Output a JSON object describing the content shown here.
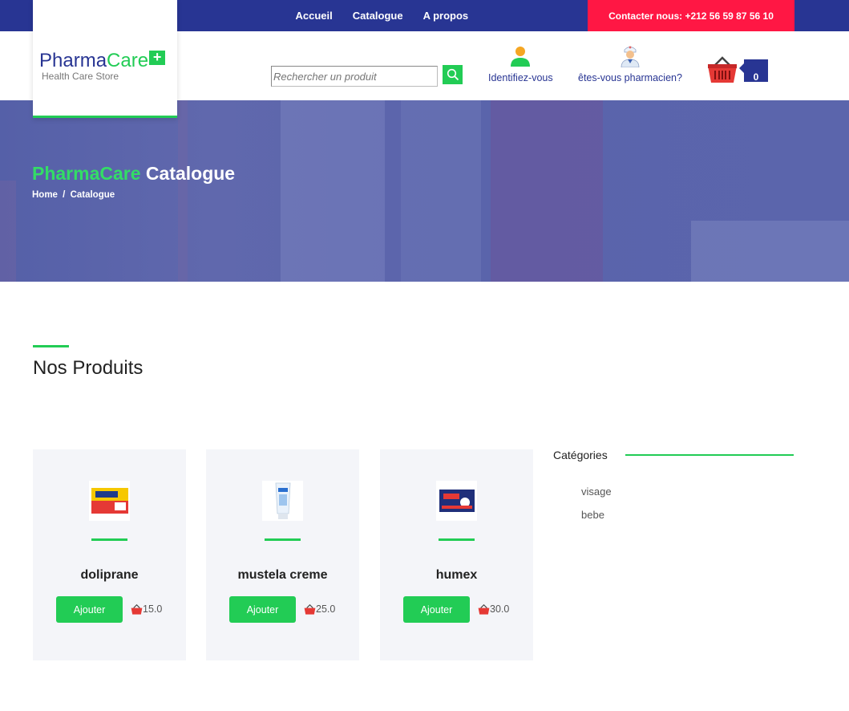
{
  "nav": {
    "items": [
      "Accueil",
      "Catalogue",
      "A propos"
    ],
    "contact": "Contacter nous: +212 56 59 87 56 10"
  },
  "logo": {
    "part1": "Pharma",
    "part2": "Care",
    "plus": "+",
    "tagline": "Health Care Store"
  },
  "search": {
    "placeholder": "Rechercher un produit"
  },
  "header": {
    "login_label": "Identifiez-vous",
    "pharmacist_label": "êtes-vous pharmacien?",
    "cart_count": "0"
  },
  "hero": {
    "title_brand": "PharmaCare",
    "title_page": "Catalogue",
    "crumb_home": "Home",
    "crumb_sep": "/",
    "crumb_current": "Catalogue"
  },
  "section": {
    "title": "Nos Produits"
  },
  "products": [
    {
      "name": "doliprane",
      "button": "Ajouter",
      "price": "15.0"
    },
    {
      "name": "mustela creme",
      "button": "Ajouter",
      "price": "25.0"
    },
    {
      "name": "humex",
      "button": "Ajouter",
      "price": "30.0"
    }
  ],
  "categories": {
    "title": "Catégories",
    "items": [
      "visage",
      "bebe"
    ]
  },
  "colors": {
    "primary": "#283593",
    "accent": "#22cc55",
    "contact": "#ff1744",
    "cart": "#e53935"
  }
}
